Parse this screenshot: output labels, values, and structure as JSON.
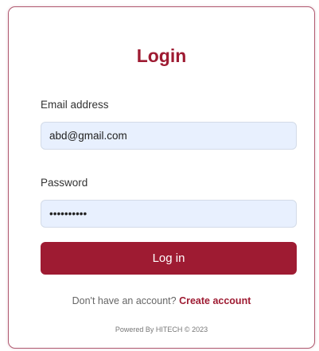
{
  "login": {
    "title": "Login",
    "email_label": "Email address",
    "email_value": "abd@gmail.com",
    "password_label": "Password",
    "password_value": "••••••••••",
    "submit_label": "Log in",
    "signup_prompt": "Don't have an account?",
    "signup_link": "Create account",
    "footer": "Powered By HITECH © 2023"
  },
  "colors": {
    "accent": "#9e1b32",
    "input_bg": "#e8f0fe",
    "card_border": "#b05a70"
  }
}
